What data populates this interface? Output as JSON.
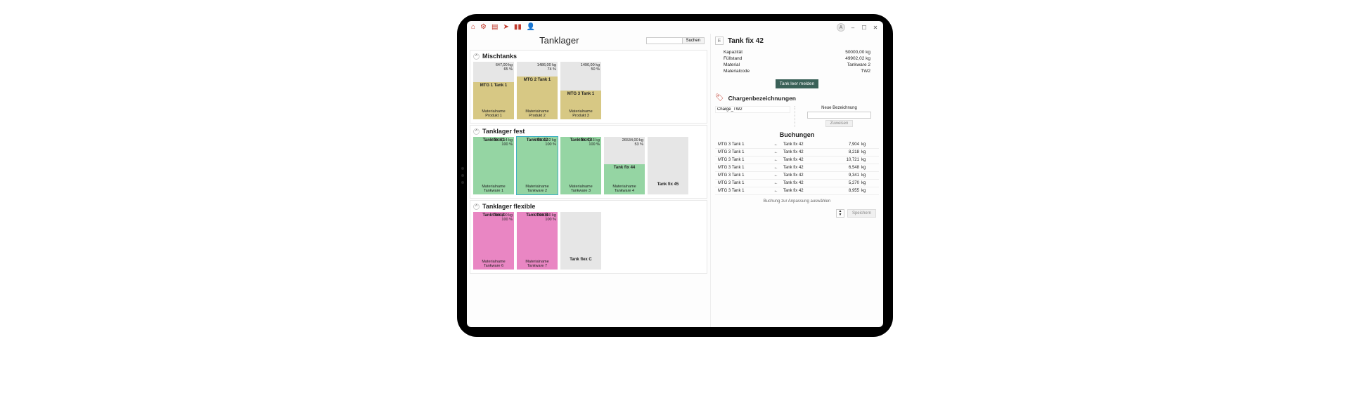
{
  "toolbar": {
    "icons": [
      "home-icon",
      "gear-icon",
      "book-icon",
      "cursor-icon",
      "chart-icon",
      "user-share-icon"
    ],
    "avatar": "A",
    "win": [
      "–",
      "☐",
      "✕"
    ]
  },
  "main": {
    "title": "Tanklager",
    "search_btn": "Suchen",
    "sections": [
      {
        "title": "Mischtanks",
        "fillClass": "fill-khaki",
        "tanks": [
          {
            "kg": "647,00 kg",
            "pct": "65 %",
            "fill": 65,
            "name": "MTG 1 Tank 1",
            "mat1": "Materialname",
            "mat2": "Produkt 1"
          },
          {
            "kg": "1486,00 kg",
            "pct": "74 %",
            "fill": 74,
            "name": "MTG 2 Tank 1",
            "mat1": "Materialname",
            "mat2": "Produkt 2"
          },
          {
            "kg": "1490,00 kg",
            "pct": "50 %",
            "fill": 50,
            "name": "MTG 3 Tank 1",
            "mat1": "Materialname",
            "mat2": "Produkt 3"
          }
        ]
      },
      {
        "title": "Tanklager fest",
        "fillClass": "fill-green",
        "tanks": [
          {
            "kg": "49930,14 kg",
            "pct": "100 %",
            "fill": 100,
            "name": "Tank fix 41",
            "mat1": "Materialname",
            "mat2": "Tankware 1"
          },
          {
            "kg": "49902,02 kg",
            "pct": "100 %",
            "fill": 100,
            "name": "Tank fix 42",
            "mat1": "Materialname",
            "mat2": "Tankware 2",
            "selected": true
          },
          {
            "kg": "49937,43 kg",
            "pct": "100 %",
            "fill": 100,
            "name": "Tank fix 43",
            "mat1": "Materialname",
            "mat2": "Tankware 3"
          },
          {
            "kg": "26534,00 kg",
            "pct": "53 %",
            "fill": 53,
            "name": "Tank fix 44",
            "mat1": "Materialname",
            "mat2": "Tankware 4"
          },
          {
            "kg": "",
            "pct": "",
            "fill": 0,
            "name": "Tank fix 45",
            "mat1": "",
            "mat2": ""
          }
        ]
      },
      {
        "title": "Tanklager flexible",
        "fillClass": "fill-pink",
        "tanks": [
          {
            "kg": "30000,00 kg",
            "pct": "100 %",
            "fill": 100,
            "name": "Tank flex A",
            "mat1": "Materialname",
            "mat2": "Tankware 6"
          },
          {
            "kg": "30000,00 kg",
            "pct": "100 %",
            "fill": 100,
            "name": "Tank flex B",
            "mat1": "Materialname",
            "mat2": "Tankware 7"
          },
          {
            "kg": "",
            "pct": "",
            "fill": 0,
            "name": "Tank flex C",
            "mat1": "",
            "mat2": ""
          }
        ]
      }
    ]
  },
  "detail": {
    "icon": "E",
    "title": "Tank fix 42",
    "rows": [
      {
        "k": "Kapazität",
        "v": "50000,00 kg"
      },
      {
        "k": "Füllstand",
        "v": "49902,02 kg"
      },
      {
        "k": "Material",
        "v": "Tankware 2"
      },
      {
        "k": "Materialcode",
        "v": "TW2"
      }
    ],
    "empty_btn": "Tank leer melden"
  },
  "charge": {
    "title": "Chargenbezeichnungen",
    "current": "Charge_TW2",
    "new_label": "Neue Bezeichnung",
    "assign_btn": "Zuweisen"
  },
  "bookings": {
    "title": "Buchungen",
    "unit": "kg",
    "rows": [
      {
        "dest": "MTG 3 Tank 1",
        "arrow": "←",
        "src": "Tank fix 42",
        "qty": "7,904"
      },
      {
        "dest": "MTG 3 Tank 1",
        "arrow": "←",
        "src": "Tank fix 42",
        "qty": "8,218"
      },
      {
        "dest": "MTG 3 Tank 1",
        "arrow": "←",
        "src": "Tank fix 42",
        "qty": "10,721"
      },
      {
        "dest": "MTG 3 Tank 1",
        "arrow": "←",
        "src": "Tank fix 42",
        "qty": "6,548"
      },
      {
        "dest": "MTG 3 Tank 1",
        "arrow": "←",
        "src": "Tank fix 42",
        "qty": "9,341"
      },
      {
        "dest": "MTG 3 Tank 1",
        "arrow": "←",
        "src": "Tank fix 42",
        "qty": "5,270"
      },
      {
        "dest": "MTG 3 Tank 1",
        "arrow": "←",
        "src": "Tank fix 42",
        "qty": "8,955"
      }
    ],
    "footer": "Buchung zur Anpassung auswählen",
    "save_btn": "Speichern"
  }
}
